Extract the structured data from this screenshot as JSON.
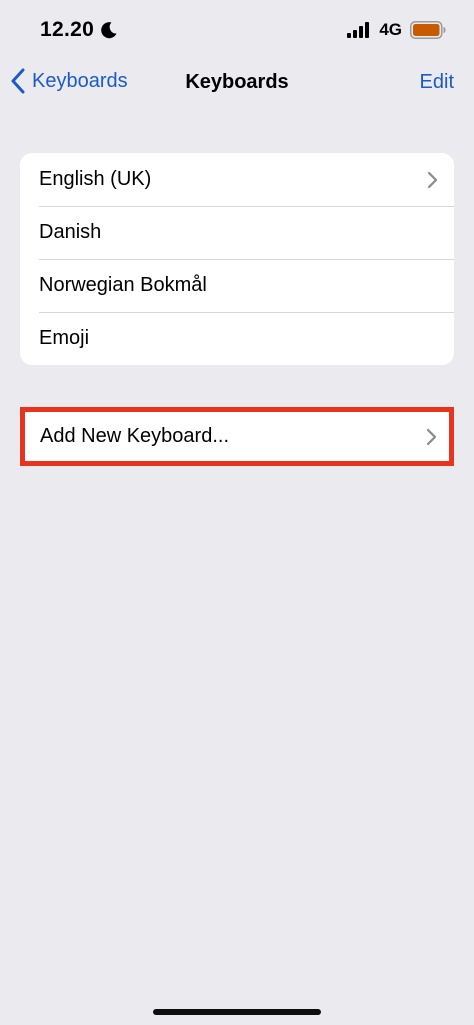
{
  "status_bar": {
    "time": "12.20",
    "network": "4G",
    "icons": [
      "moon-icon",
      "signal-icon",
      "battery-icon"
    ],
    "battery_color": "#C85A00"
  },
  "nav": {
    "back_label": "Keyboards",
    "title": "Keyboards",
    "edit_label": "Edit",
    "accent_color": "#1A5BCB"
  },
  "keyboards": {
    "items": [
      {
        "label": "English (UK)",
        "has_chevron": true
      },
      {
        "label": "Danish",
        "has_chevron": false
      },
      {
        "label": "Norwegian Bokmål",
        "has_chevron": false
      },
      {
        "label": "Emoji",
        "has_chevron": false
      }
    ]
  },
  "add_keyboard": {
    "label": "Add New Keyboard...",
    "highlight_color": "#E8341F"
  }
}
